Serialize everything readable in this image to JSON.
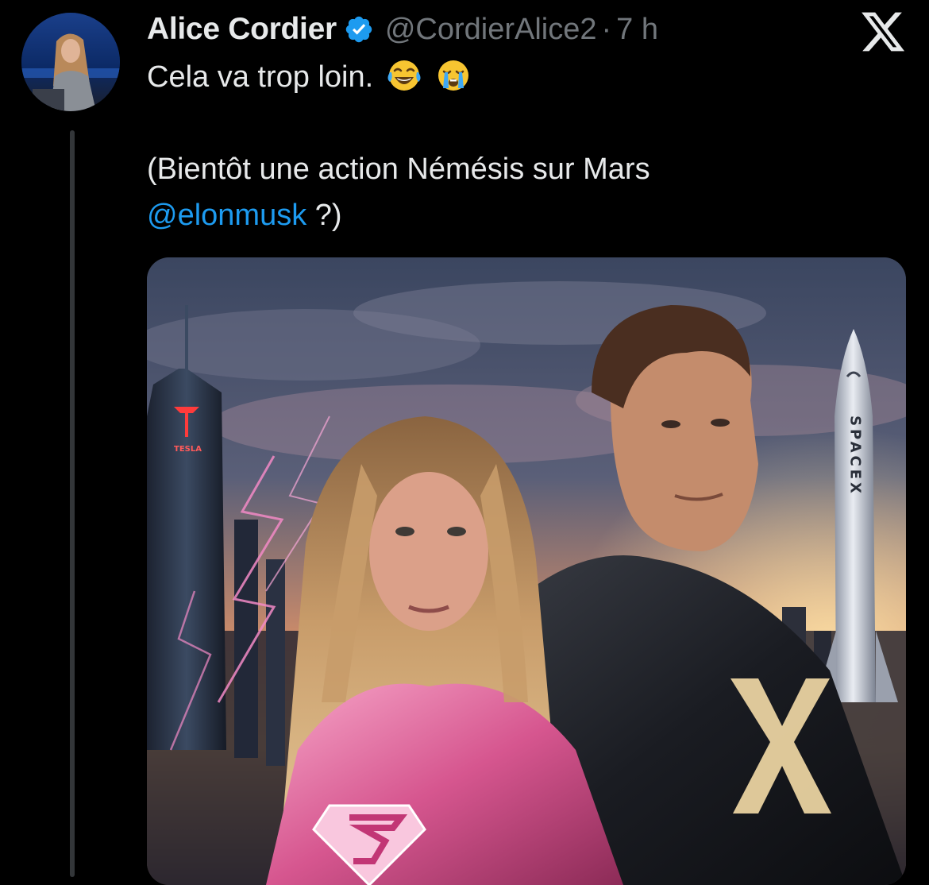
{
  "tweet": {
    "author": {
      "display_name": "Alice Cordier",
      "handle": "@CordierAlice2",
      "verified": true,
      "avatar_icon": "profile-photo"
    },
    "separator": "·",
    "timestamp": "7 h",
    "text": {
      "line1": "Cela va trop loin.",
      "line1_emojis": [
        "face-with-tears-of-joy",
        "loudly-crying-face"
      ],
      "line2": "(Bientôt une action Némésis sur Mars",
      "mention": "@elonmusk",
      "line3_rest": " ?)"
    },
    "media": {
      "kind": "image",
      "sign_text": "TESLA",
      "rocket_text": "SPACEX",
      "suit_logo": "X"
    }
  },
  "colors": {
    "background": "#000000",
    "text_primary": "#e7e9ea",
    "text_secondary": "#71767b",
    "link": "#1d9bf0",
    "verified_badge": "#1d9bf0",
    "thread_line": "#333639"
  },
  "icons": {
    "verified": "verified-badge-icon",
    "platform": "x-logo-icon"
  }
}
